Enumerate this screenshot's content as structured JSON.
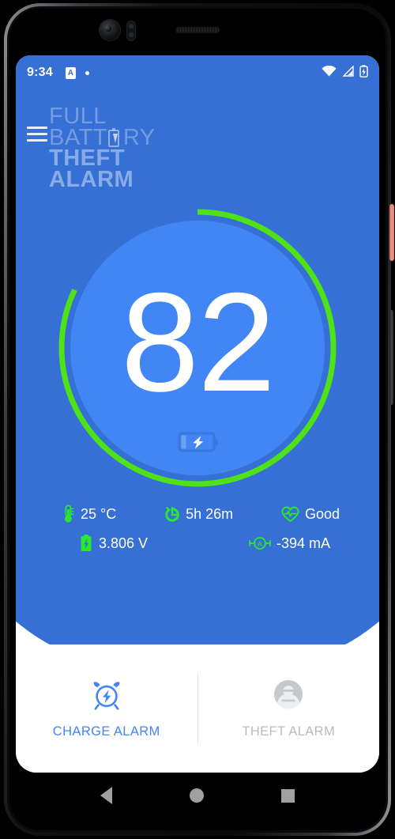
{
  "device": {
    "camera_icon": "front-camera",
    "sensor_icon": "proximity-sensor",
    "earpiece_icon": "earpiece-speaker",
    "power_button": "power-button",
    "volume_button": "volume-rocker"
  },
  "status_bar": {
    "time": "9:34",
    "left_icons": [
      {
        "name": "app-notification-badge",
        "glyph": "A"
      },
      {
        "name": "notification-dot-icon",
        "glyph": ""
      }
    ],
    "right_icons": [
      {
        "name": "wifi-icon"
      },
      {
        "name": "cellular-signal-icon"
      },
      {
        "name": "battery-charging-icon"
      }
    ]
  },
  "app_bar": {
    "menu_icon": "hamburger-menu-icon",
    "logo": {
      "line1": "FULL",
      "line2_before": "BATT",
      "line2_after": "RY",
      "line3": "THEFT",
      "line4": "ALARM",
      "battery_glyph_icon": "battery-letter-e-icon"
    }
  },
  "gauge": {
    "percent": 82,
    "value_label": "82",
    "ring_color": "#4fe317",
    "ring_track_color": "#3670d4",
    "circle_color": "#4285f4",
    "charging_icon": "battery-charging-bolt-icon",
    "start_angle_deg": 0,
    "sweep_deg": 295.2
  },
  "stats": {
    "row1": [
      {
        "icon": "thermometer-icon",
        "value": "25 °C"
      },
      {
        "icon": "timer-icon",
        "value": "5h 26m"
      },
      {
        "icon": "heart-pulse-icon",
        "value": "Good"
      }
    ],
    "row2": [
      {
        "icon": "battery-voltage-icon",
        "value": "3.806 V"
      },
      {
        "icon": "ammeter-icon",
        "value": "-394 mA"
      }
    ]
  },
  "actions": [
    {
      "icon": "alarm-clock-bolt-icon",
      "label": "CHARGE ALARM",
      "state": "active"
    },
    {
      "icon": "thief-person-icon",
      "label": "THEFT ALARM",
      "state": "inactive"
    }
  ],
  "nav_bar": [
    {
      "icon": "back-nav-icon"
    },
    {
      "icon": "home-nav-icon"
    },
    {
      "icon": "recents-nav-icon"
    }
  ],
  "colors": {
    "header_blue": "#3670d4",
    "accent_blue": "#4285f4",
    "green": "#2ce82c",
    "ring_green": "#4fe317",
    "inactive_grey": "#b9bcbf",
    "power_button": "#ef9183"
  }
}
